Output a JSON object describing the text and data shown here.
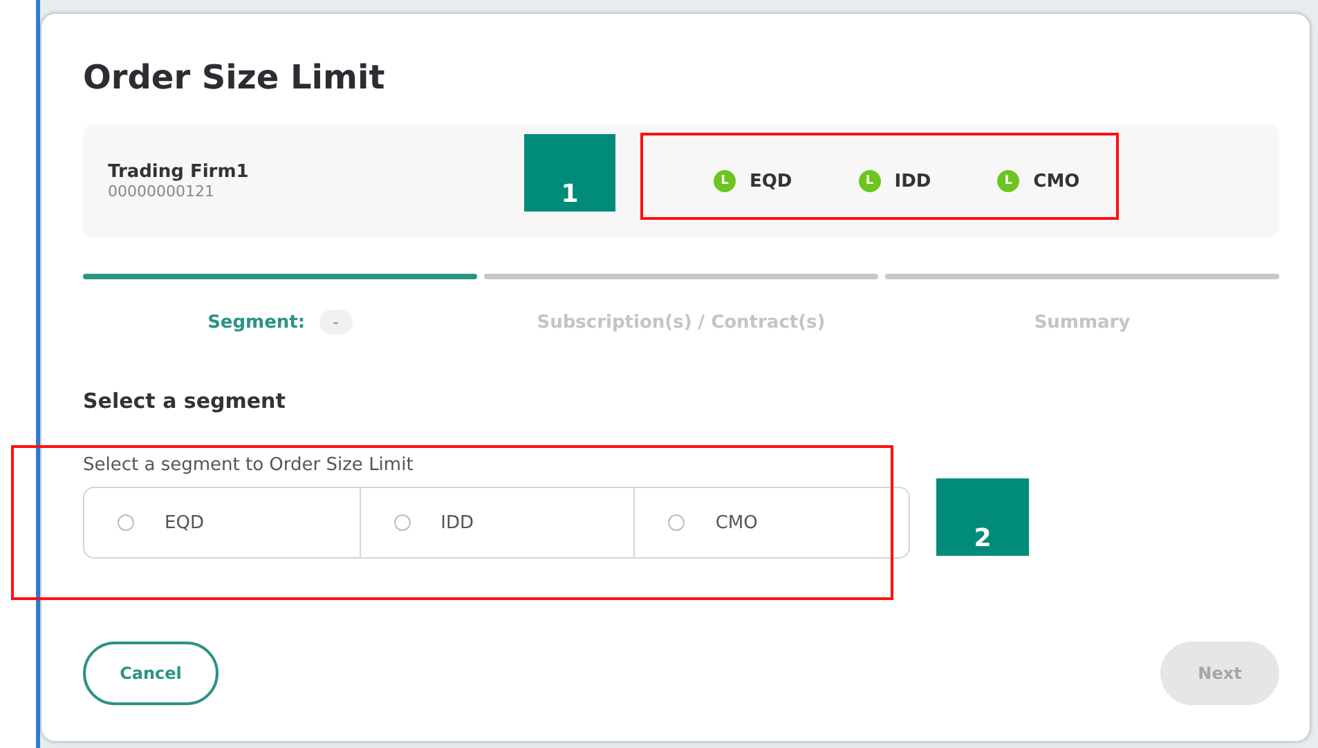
{
  "dialog": {
    "title": "Order Size Limit"
  },
  "firm": {
    "name": "Trading Firm1",
    "id": "00000000121",
    "segments": [
      {
        "badge": "L",
        "label": "EQD"
      },
      {
        "badge": "L",
        "label": "IDD"
      },
      {
        "badge": "L",
        "label": "CMO"
      }
    ]
  },
  "steps": [
    {
      "label": "Segment:",
      "value": "-",
      "selected": true
    },
    {
      "label": "Subscription(s) / Contract(s)",
      "selected": false
    },
    {
      "label": "Summary",
      "selected": false
    }
  ],
  "section_title": "Select a segment",
  "segment_picker": {
    "caption": "Select a segment to Order Size Limit",
    "options": [
      {
        "label": "EQD",
        "selected": false
      },
      {
        "label": "IDD",
        "selected": false
      },
      {
        "label": "CMO",
        "selected": false
      }
    ]
  },
  "buttons": {
    "cancel": "Cancel",
    "next": {
      "label": "Next",
      "disabled": true
    }
  },
  "annotations": [
    {
      "label": "1"
    },
    {
      "label": "2"
    }
  ]
}
